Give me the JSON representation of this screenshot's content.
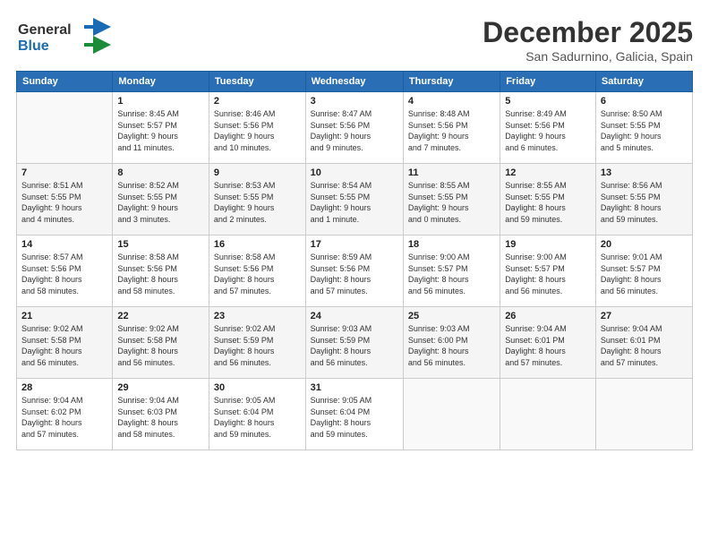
{
  "logo": {
    "general": "General",
    "blue": "Blue",
    "icon_title": "GeneralBlue Logo"
  },
  "header": {
    "month_title": "December 2025",
    "subtitle": "San Sadurnino, Galicia, Spain"
  },
  "weekdays": [
    "Sunday",
    "Monday",
    "Tuesday",
    "Wednesday",
    "Thursday",
    "Friday",
    "Saturday"
  ],
  "weeks": [
    [
      {
        "day": "",
        "info": ""
      },
      {
        "day": "1",
        "info": "Sunrise: 8:45 AM\nSunset: 5:57 PM\nDaylight: 9 hours\nand 11 minutes."
      },
      {
        "day": "2",
        "info": "Sunrise: 8:46 AM\nSunset: 5:56 PM\nDaylight: 9 hours\nand 10 minutes."
      },
      {
        "day": "3",
        "info": "Sunrise: 8:47 AM\nSunset: 5:56 PM\nDaylight: 9 hours\nand 9 minutes."
      },
      {
        "day": "4",
        "info": "Sunrise: 8:48 AM\nSunset: 5:56 PM\nDaylight: 9 hours\nand 7 minutes."
      },
      {
        "day": "5",
        "info": "Sunrise: 8:49 AM\nSunset: 5:56 PM\nDaylight: 9 hours\nand 6 minutes."
      },
      {
        "day": "6",
        "info": "Sunrise: 8:50 AM\nSunset: 5:55 PM\nDaylight: 9 hours\nand 5 minutes."
      }
    ],
    [
      {
        "day": "7",
        "info": "Sunrise: 8:51 AM\nSunset: 5:55 PM\nDaylight: 9 hours\nand 4 minutes."
      },
      {
        "day": "8",
        "info": "Sunrise: 8:52 AM\nSunset: 5:55 PM\nDaylight: 9 hours\nand 3 minutes."
      },
      {
        "day": "9",
        "info": "Sunrise: 8:53 AM\nSunset: 5:55 PM\nDaylight: 9 hours\nand 2 minutes."
      },
      {
        "day": "10",
        "info": "Sunrise: 8:54 AM\nSunset: 5:55 PM\nDaylight: 9 hours\nand 1 minute."
      },
      {
        "day": "11",
        "info": "Sunrise: 8:55 AM\nSunset: 5:55 PM\nDaylight: 9 hours\nand 0 minutes."
      },
      {
        "day": "12",
        "info": "Sunrise: 8:55 AM\nSunset: 5:55 PM\nDaylight: 8 hours\nand 59 minutes."
      },
      {
        "day": "13",
        "info": "Sunrise: 8:56 AM\nSunset: 5:55 PM\nDaylight: 8 hours\nand 59 minutes."
      }
    ],
    [
      {
        "day": "14",
        "info": "Sunrise: 8:57 AM\nSunset: 5:56 PM\nDaylight: 8 hours\nand 58 minutes."
      },
      {
        "day": "15",
        "info": "Sunrise: 8:58 AM\nSunset: 5:56 PM\nDaylight: 8 hours\nand 58 minutes."
      },
      {
        "day": "16",
        "info": "Sunrise: 8:58 AM\nSunset: 5:56 PM\nDaylight: 8 hours\nand 57 minutes."
      },
      {
        "day": "17",
        "info": "Sunrise: 8:59 AM\nSunset: 5:56 PM\nDaylight: 8 hours\nand 57 minutes."
      },
      {
        "day": "18",
        "info": "Sunrise: 9:00 AM\nSunset: 5:57 PM\nDaylight: 8 hours\nand 56 minutes."
      },
      {
        "day": "19",
        "info": "Sunrise: 9:00 AM\nSunset: 5:57 PM\nDaylight: 8 hours\nand 56 minutes."
      },
      {
        "day": "20",
        "info": "Sunrise: 9:01 AM\nSunset: 5:57 PM\nDaylight: 8 hours\nand 56 minutes."
      }
    ],
    [
      {
        "day": "21",
        "info": "Sunrise: 9:02 AM\nSunset: 5:58 PM\nDaylight: 8 hours\nand 56 minutes."
      },
      {
        "day": "22",
        "info": "Sunrise: 9:02 AM\nSunset: 5:58 PM\nDaylight: 8 hours\nand 56 minutes."
      },
      {
        "day": "23",
        "info": "Sunrise: 9:02 AM\nSunset: 5:59 PM\nDaylight: 8 hours\nand 56 minutes."
      },
      {
        "day": "24",
        "info": "Sunrise: 9:03 AM\nSunset: 5:59 PM\nDaylight: 8 hours\nand 56 minutes."
      },
      {
        "day": "25",
        "info": "Sunrise: 9:03 AM\nSunset: 6:00 PM\nDaylight: 8 hours\nand 56 minutes."
      },
      {
        "day": "26",
        "info": "Sunrise: 9:04 AM\nSunset: 6:01 PM\nDaylight: 8 hours\nand 57 minutes."
      },
      {
        "day": "27",
        "info": "Sunrise: 9:04 AM\nSunset: 6:01 PM\nDaylight: 8 hours\nand 57 minutes."
      }
    ],
    [
      {
        "day": "28",
        "info": "Sunrise: 9:04 AM\nSunset: 6:02 PM\nDaylight: 8 hours\nand 57 minutes."
      },
      {
        "day": "29",
        "info": "Sunrise: 9:04 AM\nSunset: 6:03 PM\nDaylight: 8 hours\nand 58 minutes."
      },
      {
        "day": "30",
        "info": "Sunrise: 9:05 AM\nSunset: 6:04 PM\nDaylight: 8 hours\nand 59 minutes."
      },
      {
        "day": "31",
        "info": "Sunrise: 9:05 AM\nSunset: 6:04 PM\nDaylight: 8 hours\nand 59 minutes."
      },
      {
        "day": "",
        "info": ""
      },
      {
        "day": "",
        "info": ""
      },
      {
        "day": "",
        "info": ""
      }
    ]
  ]
}
